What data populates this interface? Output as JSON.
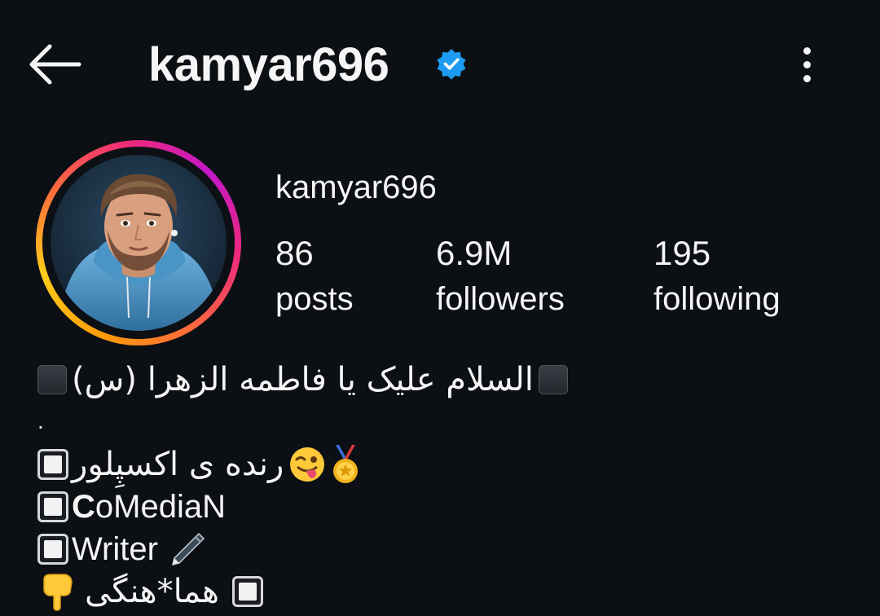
{
  "header": {
    "title": "kamyar696",
    "back_icon": "arrow-left-icon",
    "verified_icon": "verified-badge-icon",
    "more_icon": "more-vertical-icon",
    "verified_color": "#1d9bf0"
  },
  "profile": {
    "username": "kamyar696",
    "stats": {
      "posts": {
        "value": "86",
        "label": "posts"
      },
      "followers": {
        "value": "6.9M",
        "label": "followers"
      },
      "following": {
        "value": "195",
        "label": "following"
      }
    }
  },
  "bio": {
    "line1_text": "السلام علیک یا فاطمه الزهرا (س)",
    "line2_text": ".",
    "line3_text": "رنده ی اکسپِلور",
    "line4_first": "C",
    "line4_rest": "oMediaN",
    "line5_text": "Writer",
    "line6_text": "هما*هنگی",
    "icons": [
      "black-square-icon",
      "white-square-icon",
      "medal-icon",
      "winking-tongue-face-icon",
      "pen-icon",
      "pointing-down-hand-icon"
    ]
  },
  "colors": {
    "background": "#0c0f14",
    "text": "#f5f5f5",
    "story_ring_start": "#ffcc1a",
    "story_ring_end": "#c418c9"
  }
}
